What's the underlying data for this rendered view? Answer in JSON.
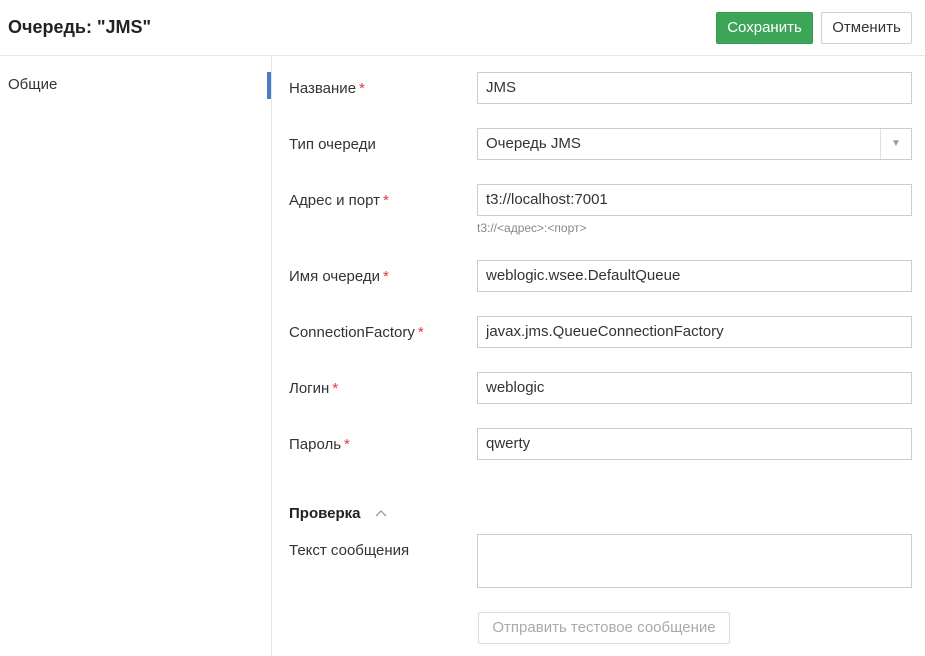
{
  "header": {
    "title": "Очередь: \"JMS\"",
    "save_label": "Сохранить",
    "cancel_label": "Отменить"
  },
  "sidebar": {
    "items": [
      {
        "label": "Общие",
        "active": true
      }
    ]
  },
  "form": {
    "required_mark": "*",
    "name": {
      "label": "Название",
      "value": "JMS",
      "required": true
    },
    "queue_type": {
      "label": "Тип очереди",
      "value": "Очередь JMS",
      "required": false
    },
    "address": {
      "label": "Адрес и порт",
      "value": "t3://localhost:7001",
      "hint": "t3://<адрес>:<порт>",
      "required": true
    },
    "queue_name": {
      "label": "Имя очереди",
      "value": "weblogic.wsee.DefaultQueue",
      "required": true
    },
    "connection_factory": {
      "label": "ConnectionFactory",
      "value": "javax.jms.QueueConnectionFactory",
      "required": true
    },
    "login": {
      "label": "Логин",
      "value": "weblogic",
      "required": true
    },
    "password": {
      "label": "Пароль",
      "value": "qwerty",
      "required": true
    }
  },
  "check_section": {
    "title": "Проверка",
    "message_label": "Текст сообщения",
    "message_value": "",
    "send_test_label": "Отправить тестовое сообщение"
  },
  "colors": {
    "save_button": "#3da557",
    "required": "#e0393e",
    "active_indicator": "#4a7bc8"
  }
}
